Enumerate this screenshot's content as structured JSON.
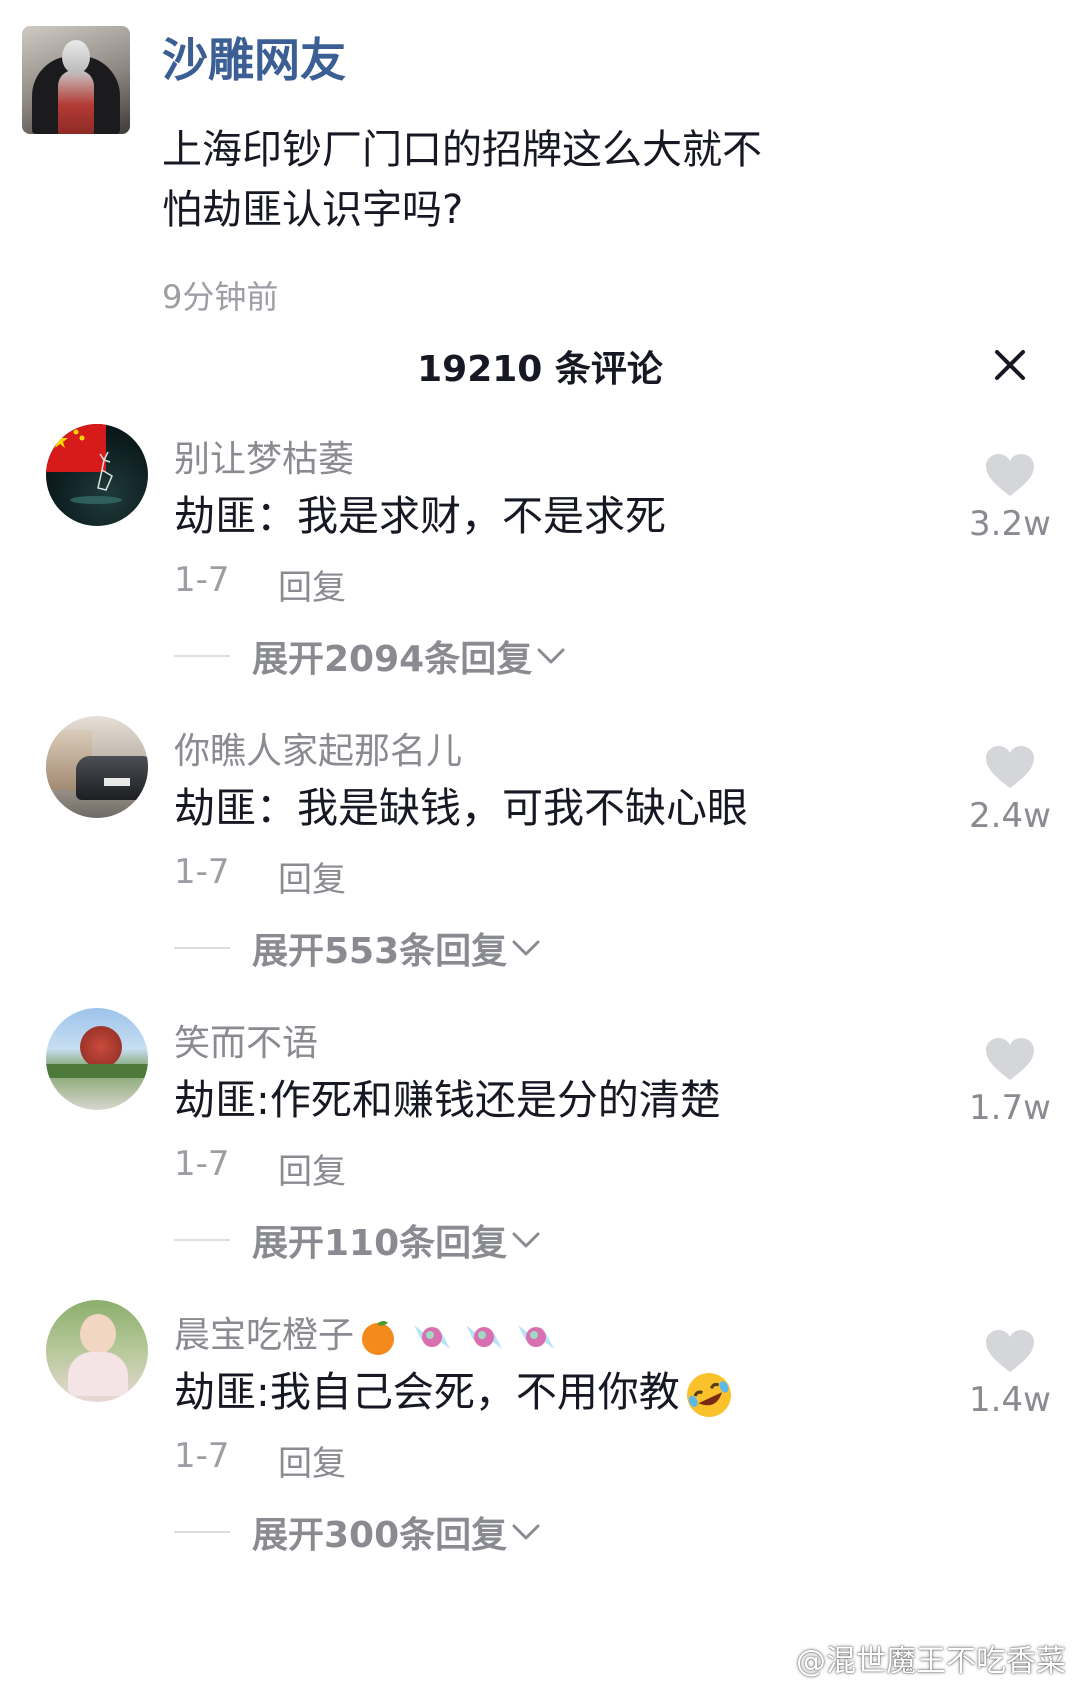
{
  "post": {
    "author": "沙雕网友",
    "text": "上海印钞厂门口的招牌这么大就不怕劫匪认识字吗?",
    "time": "9分钟前"
  },
  "comments_header": {
    "title": "19210 条评论",
    "close_icon": "close-icon"
  },
  "comments": [
    {
      "username": "别让梦枯萎",
      "text": "劫匪：我是求财，不是求死",
      "date": "1-7",
      "reply_label": "回复",
      "likes": "3.2w",
      "expand_label": "展开2094条回复"
    },
    {
      "username": "你瞧人家起那名儿",
      "text": "劫匪：我是缺钱，可我不缺心眼",
      "date": "1-7",
      "reply_label": "回复",
      "likes": "2.4w",
      "expand_label": "展开553条回复"
    },
    {
      "username": "笑而不语",
      "text": "劫匪:作死和赚钱还是分的清楚",
      "date": "1-7",
      "reply_label": "回复",
      "likes": "1.7w",
      "expand_label": "展开110条回复"
    },
    {
      "username": "晨宝吃橙子",
      "username_emojis": [
        "orange-emoji",
        "candy-emoji",
        "candy-emoji",
        "candy-emoji"
      ],
      "text": "劫匪:我自己会死，不用你教",
      "text_emoji": "rofl-emoji",
      "date": "1-7",
      "reply_label": "回复",
      "likes": "1.4w",
      "expand_label": "展开300条回复"
    }
  ],
  "watermark": "@混世魔王不吃香菜",
  "colors": {
    "author_blue": "#3b5e95",
    "text_dark": "#161823",
    "text_gray": "#8a8b91",
    "heart_gray": "#d5d6d9"
  }
}
